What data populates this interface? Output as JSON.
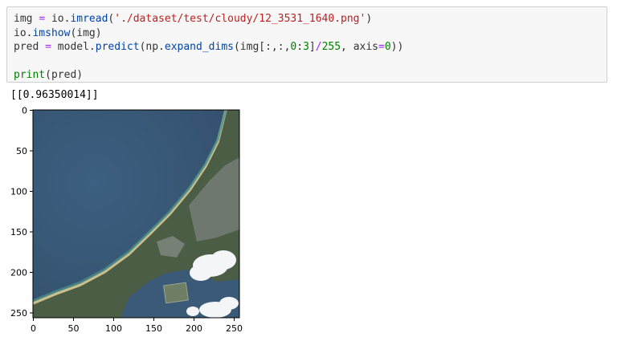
{
  "cell": {
    "lines": [
      [
        "img",
        " ",
        "=",
        " ",
        "io.",
        "imread",
        "(",
        "'./dataset/test/cloudy/12_3531_1640.png'",
        ")"
      ],
      [
        "io.",
        "imshow",
        "(img)"
      ],
      [
        "pred",
        " ",
        "=",
        " ",
        "model.",
        "predict",
        "(np.",
        "expand_dims",
        "(img[:,:,",
        "0",
        ":",
        "3",
        "]",
        "/",
        "255",
        ", axis",
        "=",
        "0",
        "))"
      ],
      [
        ""
      ],
      [
        "print",
        "(pred)"
      ]
    ]
  },
  "output": {
    "text": "[[0.96350014]]"
  },
  "plot": {
    "y_ticks": [
      "0",
      "50",
      "100",
      "150",
      "200",
      "250"
    ],
    "x_ticks": [
      "0",
      "50",
      "100",
      "150",
      "200",
      "250"
    ],
    "image_extent": [
      0,
      256
    ],
    "colors": {
      "sea": "#3a5a78",
      "sea_dark": "#34526e",
      "land": "#4e5e44",
      "land_green": "#5d7050",
      "beach": "#cbbf8e",
      "shallow": "#4d8c88",
      "cloud": "#f4f6f8",
      "urban": "#8a8f8c"
    }
  }
}
